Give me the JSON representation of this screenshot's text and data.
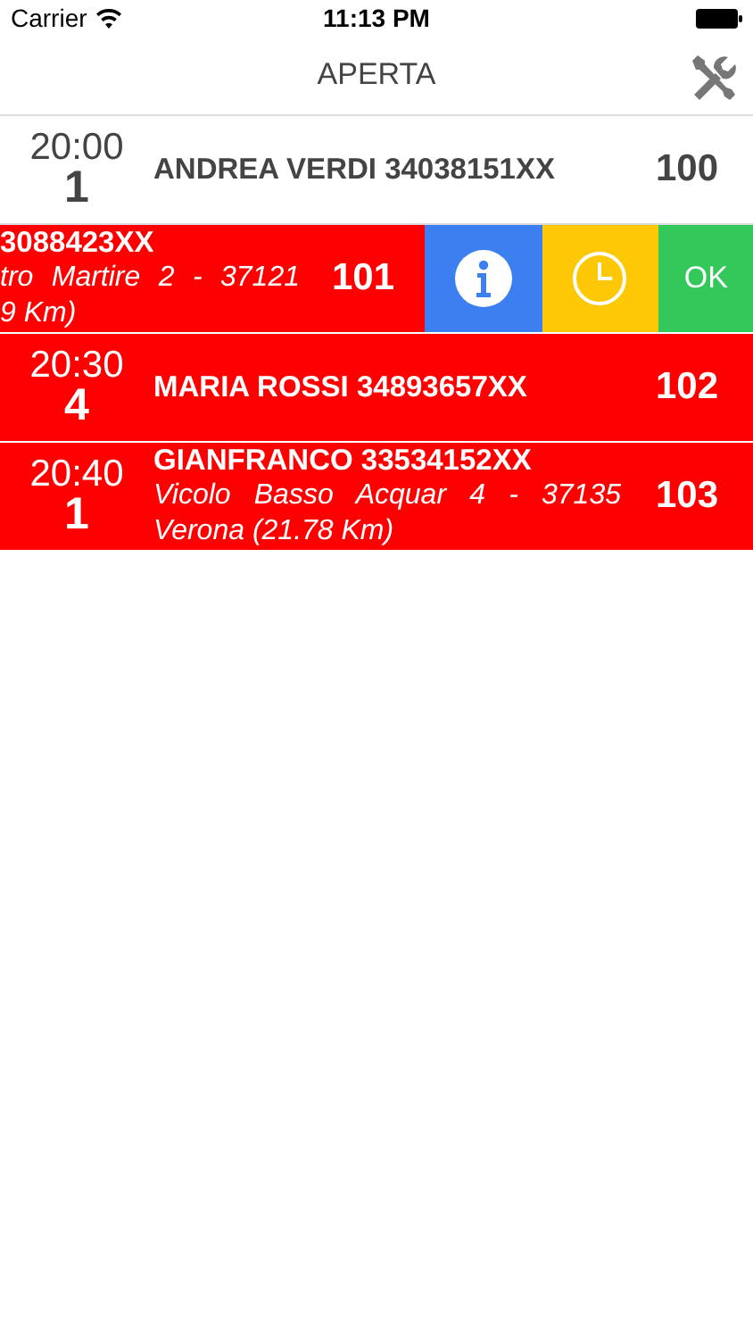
{
  "status_bar": {
    "carrier": "Carrier",
    "time": "11:13 PM"
  },
  "nav": {
    "title": "APERTA"
  },
  "rows": [
    {
      "kind": "plain",
      "time": "20:00",
      "guests": "1",
      "name": "ANDREA VERDI 34038151XX",
      "number": "100"
    },
    {
      "kind": "alert",
      "name": "3088423XX",
      "address_lines": [
        "tro Martire 2 - 37121",
        "9 Km)"
      ],
      "number": "101",
      "actions": [
        {
          "kind": "info"
        },
        {
          "kind": "clock"
        },
        {
          "kind": "text",
          "label": "OK"
        }
      ]
    },
    {
      "kind": "alert",
      "time": "20:30",
      "guests": "4",
      "name": "MARIA ROSSI 34893657XX",
      "number": "102"
    },
    {
      "kind": "alert",
      "time": "20:40",
      "guests": "1",
      "name": "GIANFRANCO 33534152XX",
      "address_lines": [
        "Vicolo Basso Acquar 4 - 37135",
        "Verona (21.78 Km)"
      ],
      "number": "103"
    }
  ]
}
